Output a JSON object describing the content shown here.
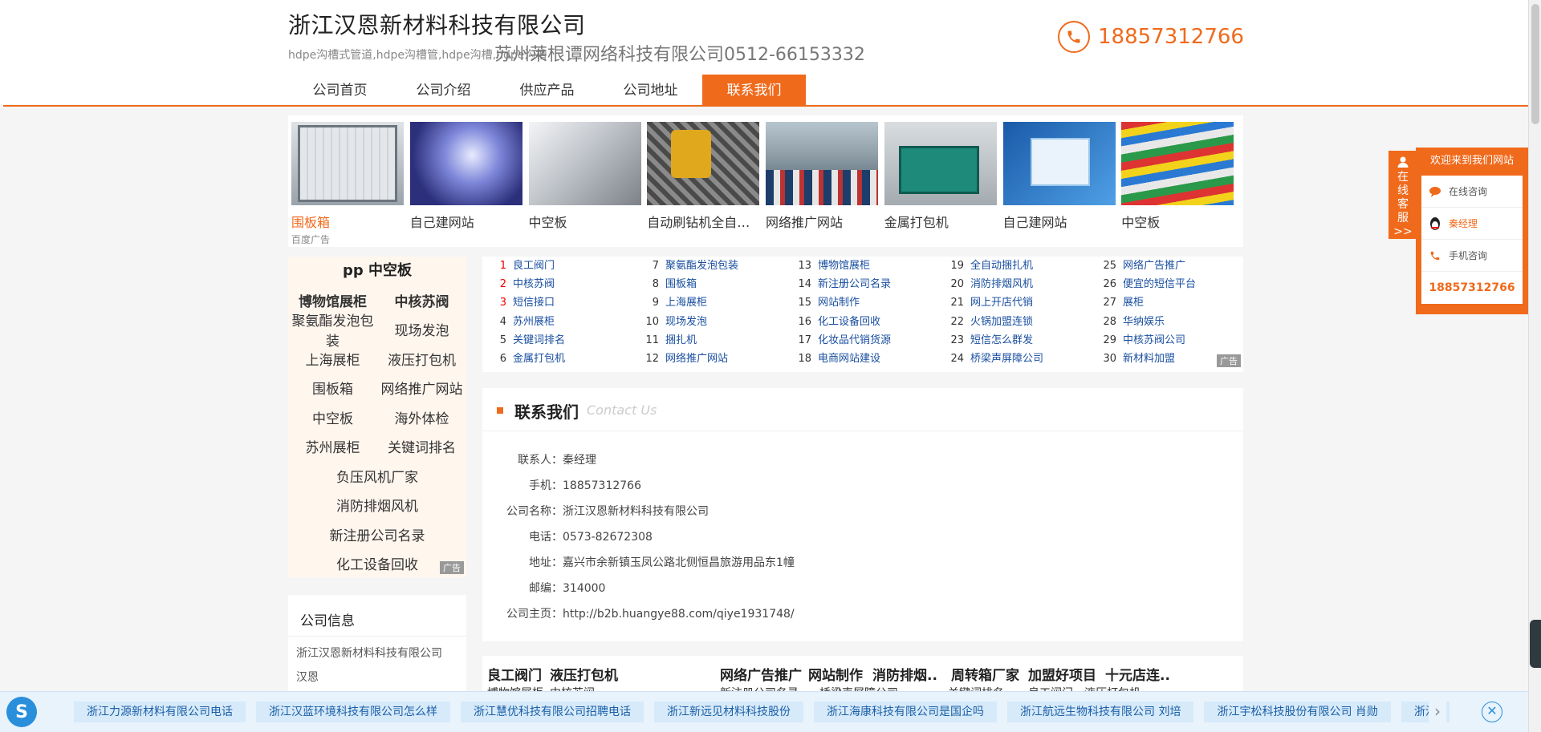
{
  "header": {
    "company_name": "浙江汉恩新材料科技有限公司",
    "subtitle": "hdpe沟槽式管道,hdpe沟槽管,hdpe沟槽,hdpe沟槽",
    "overlay_text": "苏州莱根谭网络科技有限公司0512-66153332",
    "phone": "18857312766",
    "phone_icon": "phone-icon"
  },
  "nav": {
    "items": [
      "公司首页",
      "公司介绍",
      "供应产品",
      "公司地址",
      "联系我们"
    ],
    "active_index": 4
  },
  "banner": {
    "items": [
      {
        "caption": "围板箱",
        "sub": "百度广告"
      },
      {
        "caption": "自己建网站"
      },
      {
        "caption": "中空板"
      },
      {
        "caption": "自动刷钻机全自动..."
      },
      {
        "caption": "网络推广网站"
      },
      {
        "caption": "金属打包机"
      },
      {
        "caption": "自己建网站"
      },
      {
        "caption": "中空板"
      }
    ]
  },
  "tags": {
    "title": "pp 中空板",
    "rows": [
      [
        "博物馆展柜",
        "中核苏阀"
      ],
      [
        "聚氨酯发泡包装",
        "现场发泡"
      ],
      [
        "上海展柜",
        "液压打包机"
      ],
      [
        "围板箱",
        "网络推广网站"
      ],
      [
        "中空板",
        "海外体检"
      ],
      [
        "苏州展柜",
        "关键词排名"
      ],
      [
        "负压风机厂家"
      ],
      [
        "消防排烟风机"
      ],
      [
        "新注册公司名录"
      ],
      [
        "化工设备回收"
      ]
    ],
    "ad_label": "广告"
  },
  "company_info": {
    "title": "公司信息",
    "lines": [
      "浙江汉恩新材料科技有限公司",
      "汉恩"
    ]
  },
  "keywords": {
    "columns": [
      [
        [
          "1",
          "良工阀门"
        ],
        [
          "2",
          "中核苏阀"
        ],
        [
          "3",
          "短信接口"
        ],
        [
          "4",
          "苏州展柜"
        ],
        [
          "5",
          "关键词排名"
        ],
        [
          "6",
          "金属打包机"
        ]
      ],
      [
        [
          "7",
          "聚氨酯发泡包装"
        ],
        [
          "8",
          "围板箱"
        ],
        [
          "9",
          "上海展柜"
        ],
        [
          "10",
          "现场发泡"
        ],
        [
          "11",
          "捆扎机"
        ],
        [
          "12",
          "网络推广网站"
        ]
      ],
      [
        [
          "13",
          "博物馆展柜"
        ],
        [
          "14",
          "新注册公司名录"
        ],
        [
          "15",
          "网站制作"
        ],
        [
          "16",
          "化工设备回收"
        ],
        [
          "17",
          "化妆品代销货源"
        ],
        [
          "18",
          "电商网站建设"
        ]
      ],
      [
        [
          "19",
          "全自动捆扎机"
        ],
        [
          "20",
          "消防排烟风机"
        ],
        [
          "21",
          "网上开店代销"
        ],
        [
          "22",
          "火锅加盟连锁"
        ],
        [
          "23",
          "短信怎么群发"
        ],
        [
          "24",
          "桥梁声屏障公司"
        ]
      ],
      [
        [
          "25",
          "网络广告推广"
        ],
        [
          "26",
          "便宜的短信平台"
        ],
        [
          "27",
          "展柜"
        ],
        [
          "28",
          "华纳娱乐"
        ],
        [
          "29",
          "中核苏阀公司"
        ],
        [
          "30",
          "新材料加盟"
        ]
      ]
    ],
    "ad_label": "广告"
  },
  "contact": {
    "title": "联系我们",
    "title_en": "Contact Us",
    "rows": [
      {
        "k": "联系人：",
        "v": "秦经理"
      },
      {
        "k": "手机：",
        "v": "18857312766"
      },
      {
        "k": "公司名称：",
        "v": "浙江汉恩新材料科技有限公司"
      },
      {
        "k": "电话：",
        "v": "0573-82672308"
      },
      {
        "k": "地址：",
        "v": "嘉兴市余新镇玉凤公路北侧恒昌旅游用品东1幢"
      },
      {
        "k": "邮编：",
        "v": "314000"
      },
      {
        "k": "公司主页：",
        "v": "http://b2b.huangye88.com/qiye1931748/"
      }
    ]
  },
  "bottom_keywords": {
    "row1": [
      "良工阀门",
      "液压打包机",
      "网络广告推广",
      "网站制作",
      "消防排烟..",
      "周转箱厂家",
      "加盟好项目",
      "十元店连.."
    ],
    "row2": [
      "博物馆展柜",
      "中核苏阀",
      "新注册公司名录",
      "桥梁声屏障公司",
      "关键词排名",
      "良工阀门",
      "液压打包机"
    ]
  },
  "customer_service": {
    "tab_text": "在线客服",
    "tab_arrow": ">>",
    "welcome": "欢迎来到我们网站",
    "items": [
      {
        "label": "在线咨询",
        "icon": "chat-bubble-icon"
      },
      {
        "label": "秦经理",
        "icon": "qq-penguin-icon"
      },
      {
        "label": "手机咨询",
        "icon": "phone-icon"
      }
    ],
    "phone": "18857312766"
  },
  "bottom_bar": {
    "logo": "S",
    "logo_icon": "sogou-logo-icon",
    "items": [
      "浙江力源新材料有限公司电话",
      "浙江汉蓝环境科技有限公司怎么样",
      "浙江慧优科技有限公司招聘电话",
      "浙江新远见材料科技股份",
      "浙江海康科技有限公司是国企吗",
      "浙江航远生物科技有限公司 刘培",
      "浙江宇松科技股份有限公司 肖勋",
      "浙江"
    ],
    "next_icon": "chevron-right-icon",
    "close_icon": "close-icon"
  },
  "colors": {
    "accent": "#f06a1c",
    "link": "#1a4fa0",
    "bar_bg": "#e9f3fc"
  }
}
